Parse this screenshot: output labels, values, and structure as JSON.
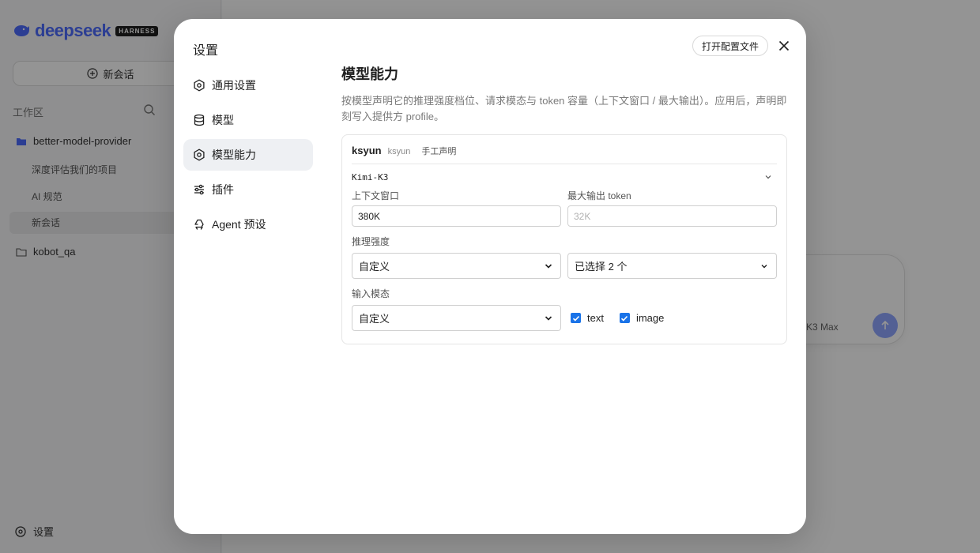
{
  "background": {
    "logo": "deepseek",
    "logo_badge": "HARNESS",
    "new_chat": "新会话",
    "workspace_label": "工作区",
    "projects": [
      {
        "name": "better-model-provider"
      },
      {
        "name": "kobot_qa"
      }
    ],
    "chats": [
      "深度评估我们的项目",
      "AI 规范",
      "新会话"
    ],
    "settings_label": "设置",
    "composer_model": "K3 Max"
  },
  "modal": {
    "title": "设置",
    "open_config_label": "打开配置文件",
    "nav": [
      {
        "label": "通用设置",
        "icon": "gear-icon"
      },
      {
        "label": "模型",
        "icon": "database-icon"
      },
      {
        "label": "模型能力",
        "icon": "gear-icon",
        "active": true
      },
      {
        "label": "插件",
        "icon": "sliders-icon"
      },
      {
        "label": "Agent 预设",
        "icon": "recycle-icon"
      }
    ],
    "content": {
      "title": "模型能力",
      "description": "按模型声明它的推理强度档位、请求模态与 token 容量（上下文窗口 / 最大输出）。应用后，声明即刻写入提供方 profile。",
      "provider": {
        "name": "ksyun",
        "id": "ksyun",
        "tag": "手工声明"
      },
      "model": "Kimi-K3",
      "context_window": {
        "label": "上下文窗口",
        "value": "380K"
      },
      "max_output": {
        "label": "最大输出 token",
        "placeholder": "32K"
      },
      "reasoning": {
        "label": "推理强度",
        "mode": "自定义",
        "selection": "已选择 2 个"
      },
      "input_modality": {
        "label": "输入模态",
        "mode": "自定义",
        "options": [
          {
            "label": "text",
            "checked": true
          },
          {
            "label": "image",
            "checked": true
          }
        ]
      }
    }
  },
  "colors": {
    "accent": "#1a73e8",
    "brand": "#4d6bfe",
    "nav_active_bg": "#eef0f3"
  }
}
